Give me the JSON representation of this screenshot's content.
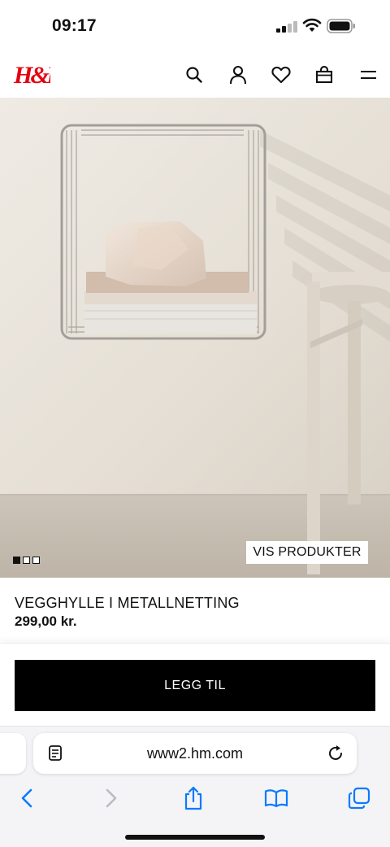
{
  "status_bar": {
    "time": "09:17"
  },
  "header": {
    "logo": "H&M",
    "icons": [
      "search-icon",
      "account-icon",
      "favorites-icon",
      "shopping-bag-icon",
      "menu-icon"
    ]
  },
  "hero": {
    "carousel": {
      "slides": 3,
      "active": 1
    },
    "cta_label": "VIS PRODUKTER"
  },
  "product": {
    "name": "VEGGHYLLE I METALLNETTING",
    "price": "299,00 kr."
  },
  "add_button": {
    "label": "LEGG TIL"
  },
  "browser": {
    "url": "www2.hm.com",
    "icons": [
      "back-icon",
      "forward-icon",
      "share-icon",
      "bookmarks-icon",
      "tabs-icon"
    ]
  },
  "colors": {
    "brand_red": "#e50010",
    "button_black": "#000000",
    "link_blue": "#0a7aff"
  }
}
